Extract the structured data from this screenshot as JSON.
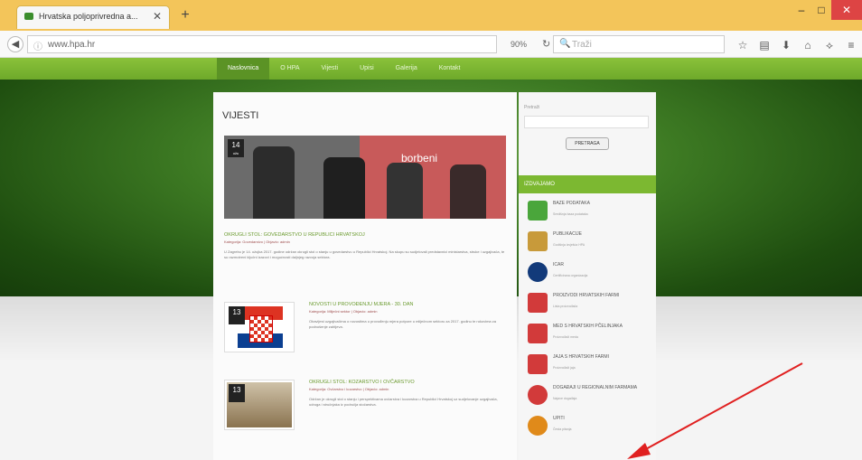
{
  "browser": {
    "tab_title": "Hrvatska poljoprivredna a...",
    "tab_close": "✕",
    "new_tab": "+",
    "url": "www.hpa.hr",
    "zoom": "90%",
    "search_placeholder": "Traži",
    "win_min": "–",
    "win_max": "□",
    "win_close": "✕"
  },
  "site": {
    "menu": [
      "Naslovnica",
      "O HPA",
      "Vijesti",
      "Upisi",
      "Galerija",
      "Kontakt"
    ],
    "section_title": "VIJESTI",
    "featured": {
      "date_day": "14",
      "date_month": "ožu",
      "banner_word": "borbeni"
    },
    "lead": {
      "title": "OKRUGLI STOL: GOVEDARSTVO U REPUBLICI HRVATSKOJ",
      "meta": "Kategorija: Govedarstvo | Objavio: admin",
      "text": "U Zagrebu je 14. ožujka 2017. godine održan okrugli stol o stanju u govedarstvu u Republici Hrvatskoj. Na skupu su sudjelovali predstavnici ministarstva, struke i uzgajivača, te su razmotreni ključni izazovi i mogućnosti daljnjeg razvoja sektora."
    },
    "items": [
      {
        "date_day": "13",
        "title": "NOVOSTI U PROVOĐENJU MJERA - 30. DAN",
        "meta": "Kategorija: Mliječni sektor | Objavio: admin",
        "text": "Obavijest uzgajivačima o novostima u provođenju mjera potpore u mliječnom sektoru za 2017. godinu te rokovima za podnošenje zahtjeva."
      },
      {
        "date_day": "13",
        "title": "OKRUGLI STOL: KOZARSTVO I OVČARSTVO",
        "meta": "Kategorija: Ovčarstvo i kozarstvo | Objavio: admin",
        "text": "Održan je okrugli stol o stanju i perspektivama ovčarstva i kozarstva u Republici Hrvatskoj uz sudjelovanje uzgajivača, udruga i stručnjaka iz područja stočarstva."
      }
    ]
  },
  "sidebar": {
    "search_label": "Pretraži",
    "search_button": "PRETRAGA",
    "heading": "IZDVAJAMO",
    "links": [
      {
        "title": "BAZE PODATAKA",
        "sub": "Središnja baza podataka",
        "color": "#4aa63b",
        "icon": "database-icon"
      },
      {
        "title": "PUBLIKACIJE",
        "sub": "Godišnja izvješća HPA",
        "color": "#c89a3a",
        "icon": "book-icon"
      },
      {
        "title": "ICAR",
        "sub": "Certificirana organizacija",
        "color": "#123a7a",
        "icon": "icar-logo-icon"
      },
      {
        "title": "PROIZVODI HRVATSKIH FARMI",
        "sub": "Lista proizvođača",
        "color": "#d23a3a",
        "icon": "farm-products-icon"
      },
      {
        "title": "MED S HRVATSKIH PČELINJAKA",
        "sub": "Proizvođači meda",
        "color": "#d23a3a",
        "icon": "honey-icon"
      },
      {
        "title": "JAJA S HRVATSKIH FARMI",
        "sub": "Proizvođači jaja",
        "color": "#d23a3a",
        "icon": "eggs-icon"
      },
      {
        "title": "DOGAĐAJI U REGIONALNIM FARMAMA",
        "sub": "Najave događaja",
        "color": "#d23a3a",
        "icon": "events-icon"
      },
      {
        "title": "UPITI",
        "sub": "Česta pitanja",
        "color": "#e08a1a",
        "icon": "question-icon"
      }
    ]
  },
  "colors": {
    "brand_green": "#7cb831",
    "annotation_arrow": "#e02020"
  }
}
